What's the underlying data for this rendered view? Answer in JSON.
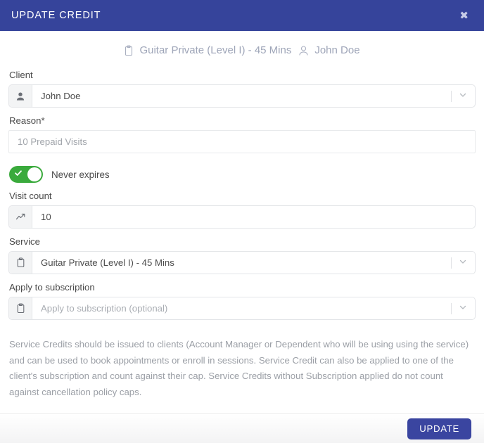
{
  "header": {
    "title": "UPDATE CREDIT",
    "close_label": "✖",
    "background_color": "#36449b"
  },
  "subtitle": {
    "service": "Guitar Private (Level I) - 45 Mins",
    "service_icon": "clipboard-icon",
    "client": "John Doe",
    "client_icon": "user-outline-icon"
  },
  "fields": {
    "client": {
      "label": "Client",
      "value": "John Doe",
      "icon": "user-filled-icon",
      "has_dropdown": true
    },
    "reason": {
      "label": "Reason*",
      "value": "",
      "placeholder": "10 Prepaid Visits"
    },
    "never_expires": {
      "label": "Never expires",
      "checked": true,
      "on_color": "#3aaa3c"
    },
    "visit_count": {
      "label": "Visit count",
      "value": "10",
      "icon": "trending-up-icon",
      "has_dropdown": false
    },
    "service": {
      "label": "Service",
      "value": "Guitar Private (Level I) - 45 Mins",
      "icon": "clipboard-icon",
      "has_dropdown": true
    },
    "apply_to_subscription": {
      "label": "Apply to subscription",
      "value": "",
      "placeholder": "Apply to subscription (optional)",
      "icon": "clipboard-icon",
      "has_dropdown": true
    }
  },
  "help_text": "Service Credits should be issued to clients (Account Manager or Dependent who will be using using the service) and can be used to book appointments or enroll in sessions. Service Credit can also be applied to one of the client's subscription and count against their cap. Service Credits without Subscription applied do not count against cancellation policy caps.",
  "footer": {
    "update_label": "UPDATE",
    "button_color": "#3a45a0"
  }
}
